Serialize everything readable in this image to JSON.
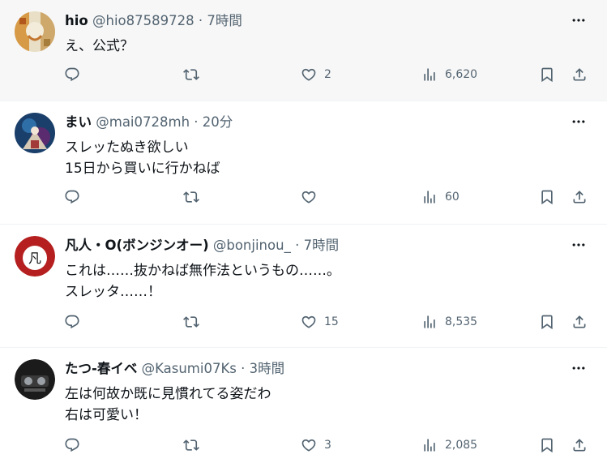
{
  "tweets": [
    {
      "name": "hio",
      "handle": "@hio87589728",
      "dot": "·",
      "time": "7時間",
      "body": "え、公式？",
      "likes": "2",
      "views": "6,620"
    },
    {
      "name": "まい",
      "handle": "@mai0728mh",
      "dot": "·",
      "time": "20分",
      "body": "スレッたぬき欲しい\n15日から買いに行かねば",
      "likes": "",
      "views": "60"
    },
    {
      "name": "凡人・O(ボンジンオー)",
      "handle": "@bonjinou_",
      "dot": "·",
      "time": "7時間",
      "body": "これは……抜かねば無作法というもの……。\nスレッタ……！",
      "likes": "15",
      "views": "8,535"
    },
    {
      "name": "たつ-春イベ",
      "handle": "@Kasumi07Ks",
      "dot": "·",
      "time": "3時間",
      "body": "左は何故か既に見慣れてる姿だわ\n右は可愛い！",
      "likes": "3",
      "views": "2,085"
    }
  ],
  "avatar_text": "凡",
  "icons": [
    "more-icon",
    "reply-icon",
    "retweet-icon",
    "like-icon",
    "views-icon",
    "bookmark-icon",
    "share-icon"
  ],
  "colors": {
    "text": "#0f1419",
    "muted": "#536471",
    "highlight_bg": "#f7f7f7",
    "border": "#eff3f4"
  }
}
